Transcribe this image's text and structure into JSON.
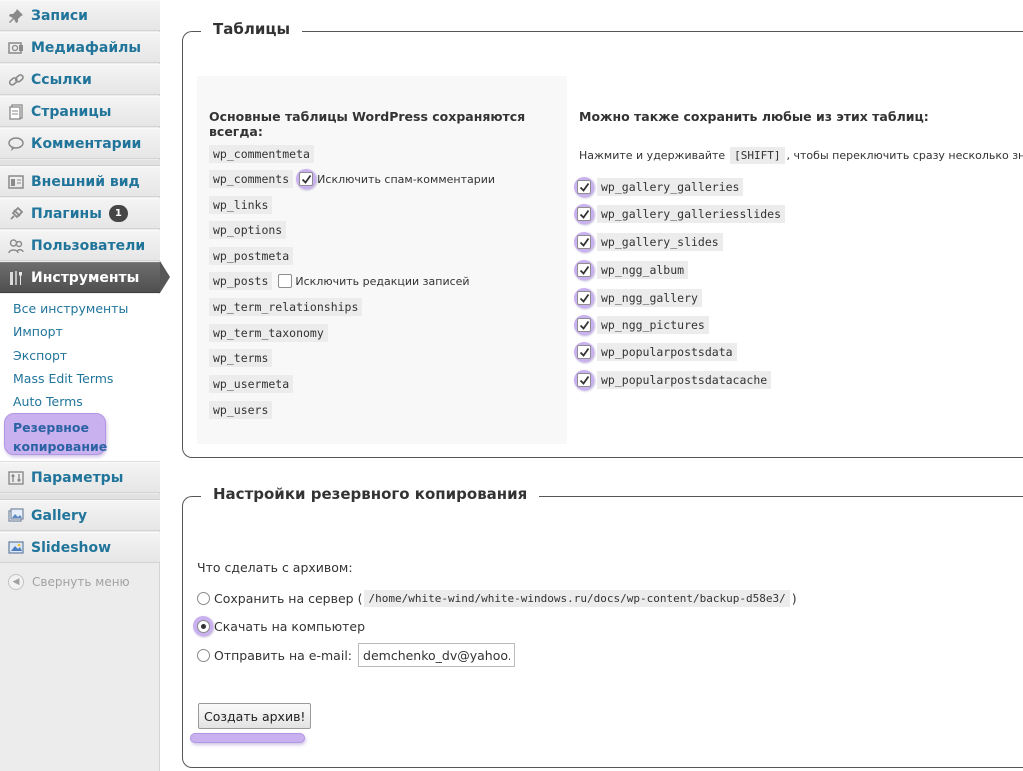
{
  "sidebar": {
    "items": [
      {
        "label": "Записи",
        "icon": "pin-icon"
      },
      {
        "label": "Медиафайлы",
        "icon": "media-icon"
      },
      {
        "label": "Ссылки",
        "icon": "link-icon"
      },
      {
        "label": "Страницы",
        "icon": "pages-icon"
      },
      {
        "label": "Комментарии",
        "icon": "comment-icon"
      },
      {
        "label": "Внешний вид",
        "icon": "appearance-icon"
      },
      {
        "label": "Плагины",
        "icon": "plugin-icon",
        "badge": "1"
      },
      {
        "label": "Пользователи",
        "icon": "users-icon"
      },
      {
        "label": "Инструменты",
        "icon": "tools-icon"
      },
      {
        "label": "Параметры",
        "icon": "settings-icon"
      },
      {
        "label": "Gallery",
        "icon": "gallery-icon"
      },
      {
        "label": "Slideshow",
        "icon": "slideshow-icon"
      }
    ],
    "submenu": [
      "Все инструменты",
      "Импорт",
      "Экспорт",
      "Mass Edit Terms",
      "Auto Terms"
    ],
    "submenu_current": {
      "line1": "Резервное",
      "line2": "копирование"
    },
    "collapse": "Свернуть меню"
  },
  "tables": {
    "legend": "Таблицы",
    "core_heading": "Основные таблицы WordPress сохраняются всегда:",
    "core": [
      "wp_commentmeta",
      "wp_comments",
      "wp_links",
      "wp_options",
      "wp_postmeta",
      "wp_posts",
      "wp_term_relationships",
      "wp_term_taxonomy",
      "wp_terms",
      "wp_usermeta",
      "wp_users"
    ],
    "exclude_spam": {
      "label": "Исключить спам-комментарии",
      "checked": true
    },
    "exclude_revisions": {
      "label": "Исключить редакции записей",
      "checked": false
    },
    "extra_heading": "Можно также сохранить любые из этих таблиц:",
    "extra_note_before": "Нажмите и удерживайте",
    "extra_note_key": "[SHIFT]",
    "extra_note_after": ", чтобы переключить сразу несколько значений",
    "extra": [
      "wp_gallery_galleries",
      "wp_gallery_galleriesslides",
      "wp_gallery_slides",
      "wp_ngg_album",
      "wp_ngg_gallery",
      "wp_ngg_pictures",
      "wp_popularpostsdata",
      "wp_popularpostsdatacache"
    ]
  },
  "settings": {
    "legend": "Настройки резервного копирования",
    "question": "Что сделать с архивом:",
    "save_server": "Сохранить на сервер",
    "server_path_open": "(",
    "server_path": "/home/white-wind/white-windows.ru/docs/wp-content/backup-d58e3/",
    "server_path_close": ")",
    "download": "Скачать на компьютер",
    "email": "Отправить на e-mail:",
    "email_value": "demchenko_dv@yahoo.com",
    "selected": "download",
    "submit": "Создать архив!"
  },
  "colors": {
    "link": "#21759b",
    "highlight": "#c9b1f0",
    "active_menu": "#575757"
  }
}
